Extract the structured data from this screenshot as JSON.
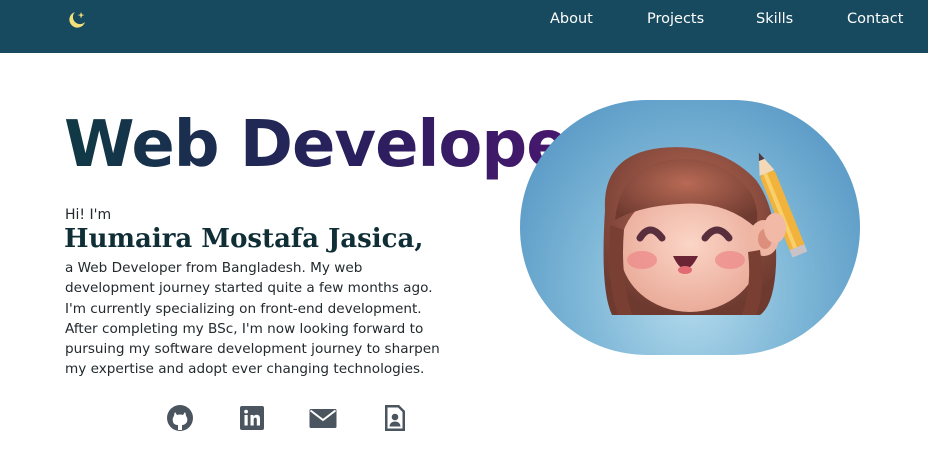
{
  "nav": {
    "logo_icon": "moon-star-icon",
    "items": [
      {
        "label": "About"
      },
      {
        "label": "Projects"
      },
      {
        "label": "Skills"
      },
      {
        "label": "Contact"
      }
    ]
  },
  "hero": {
    "title": "Web Developer",
    "greeting": "Hi! I'm",
    "name": "Humaira Mostafa Jasica,",
    "bio": "a Web Developer from Bangladesh. My web development journey started quite a few months ago. I'm currently specializing on front-end development. After completing my BSc, I'm now looking forward to pursuing my software development journey to sharpen my expertise and adopt ever changing technologies."
  },
  "social": [
    {
      "icon": "github-icon"
    },
    {
      "icon": "linkedin-icon"
    },
    {
      "icon": "mail-icon"
    },
    {
      "icon": "resume-icon"
    }
  ],
  "avatar": {
    "icon": "avatar-illustration"
  },
  "colors": {
    "navbar_bg": "#174a5f",
    "title_gradient_start": "#0f3a44",
    "title_gradient_end": "#4d1671",
    "icon_color": "#4b5560",
    "avatar_bg": "#7eb7d7"
  }
}
